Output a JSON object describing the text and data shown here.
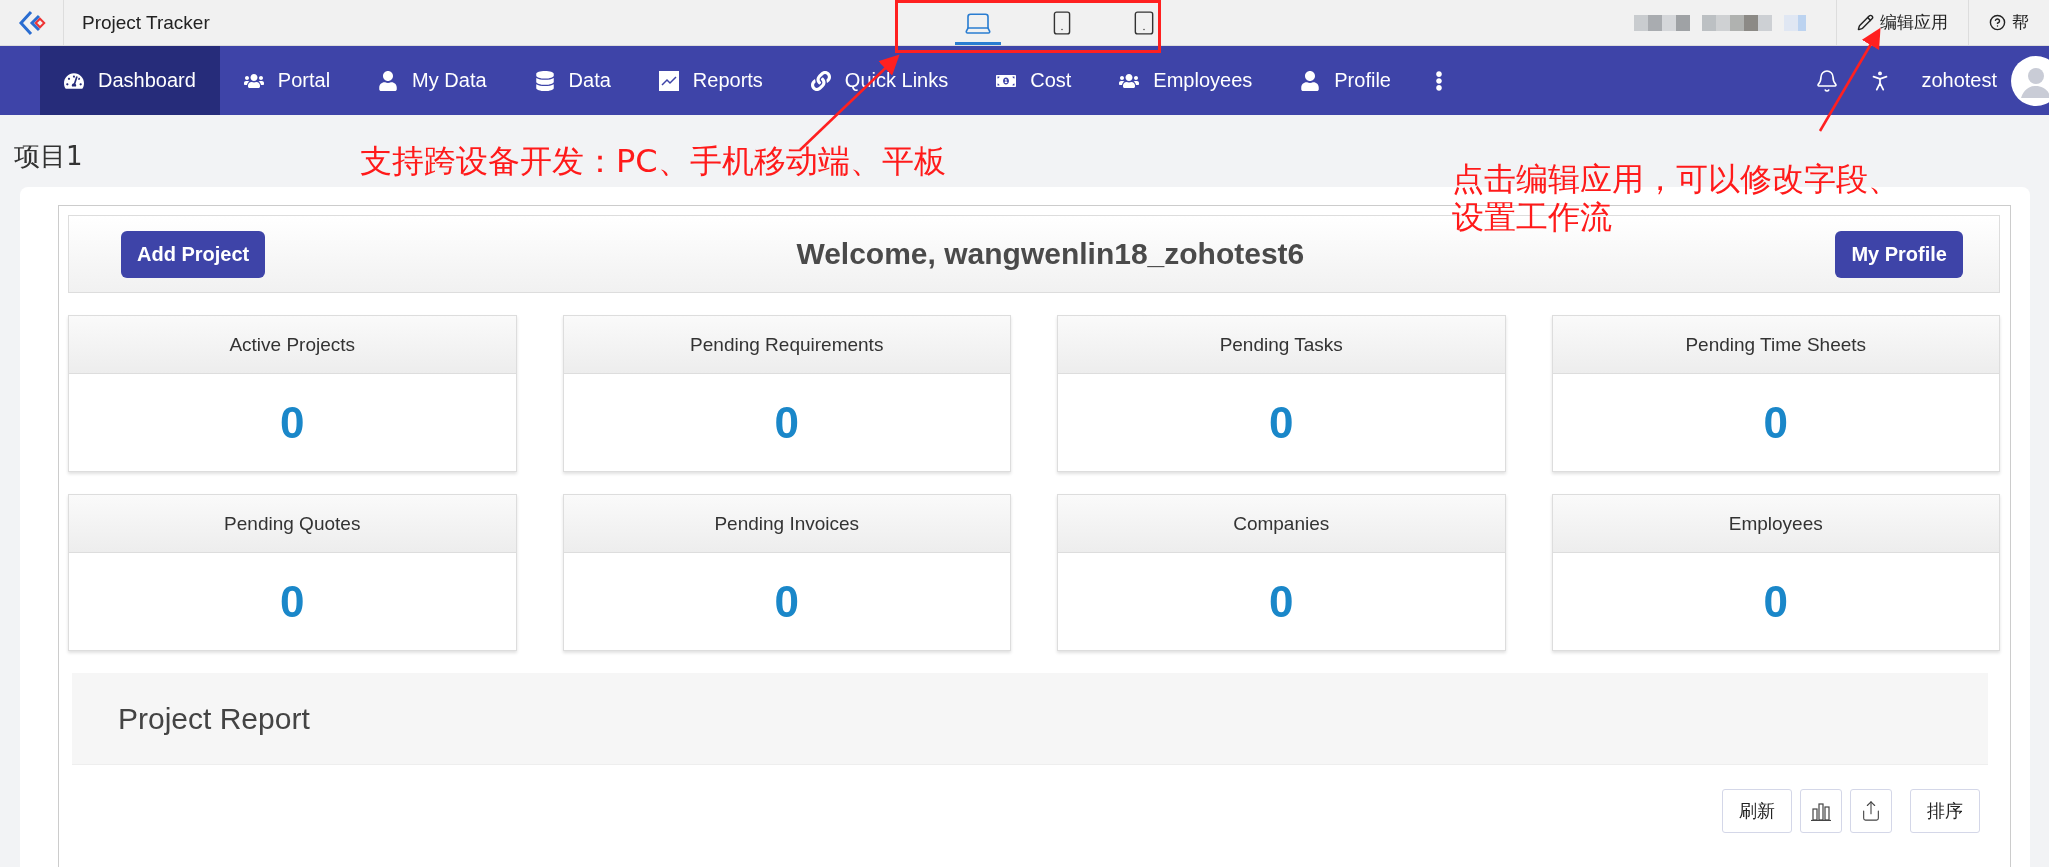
{
  "app": {
    "title": "Project Tracker"
  },
  "device_switcher": [
    {
      "kind": "laptop",
      "selected": true
    },
    {
      "kind": "phone",
      "selected": false
    },
    {
      "kind": "tablet",
      "selected": false
    }
  ],
  "top_actions": [
    {
      "kind": "edit",
      "label": "编辑应用"
    },
    {
      "kind": "help",
      "label": "帮"
    }
  ],
  "nav": {
    "items": [
      {
        "kind": "dashboard",
        "label": "Dashboard",
        "selected": true
      },
      {
        "kind": "group",
        "label": "Portal",
        "selected": false
      },
      {
        "kind": "person",
        "label": "My Data",
        "selected": false
      },
      {
        "kind": "database",
        "label": "Data",
        "selected": false
      },
      {
        "kind": "report",
        "label": "Reports",
        "selected": false
      },
      {
        "kind": "link",
        "label": "Quick Links",
        "selected": false
      },
      {
        "kind": "money",
        "label": "Cost",
        "selected": false
      },
      {
        "kind": "group",
        "label": "Employees",
        "selected": false
      },
      {
        "kind": "person",
        "label": "Profile",
        "selected": false
      }
    ],
    "user": "zohotest"
  },
  "page_title": "项目1",
  "welcome": {
    "add_button": "Add Project",
    "text": "Welcome, wangwenlin18_zohotest6",
    "profile_button": "My Profile"
  },
  "stats": [
    {
      "label": "Active Projects",
      "value": "0"
    },
    {
      "label": "Pending Requirements",
      "value": "0"
    },
    {
      "label": "Pending Tasks",
      "value": "0"
    },
    {
      "label": "Pending Time Sheets",
      "value": "0"
    },
    {
      "label": "Pending Quotes",
      "value": "0"
    },
    {
      "label": "Pending Invoices",
      "value": "0"
    },
    {
      "label": "Companies",
      "value": "0"
    },
    {
      "label": "Employees",
      "value": "0"
    }
  ],
  "report": {
    "title": "Project Report",
    "toolbar": [
      {
        "kind": "text",
        "label": "刷新"
      },
      {
        "kind": "chart"
      },
      {
        "kind": "export"
      },
      {
        "kind": "text",
        "label": "排序"
      }
    ]
  },
  "annotations": [
    {
      "text": "支持跨设备开发：PC、手机移动端、平板"
    },
    {
      "text": "点击编辑应用，可以修改字段、设置工作流"
    }
  ]
}
